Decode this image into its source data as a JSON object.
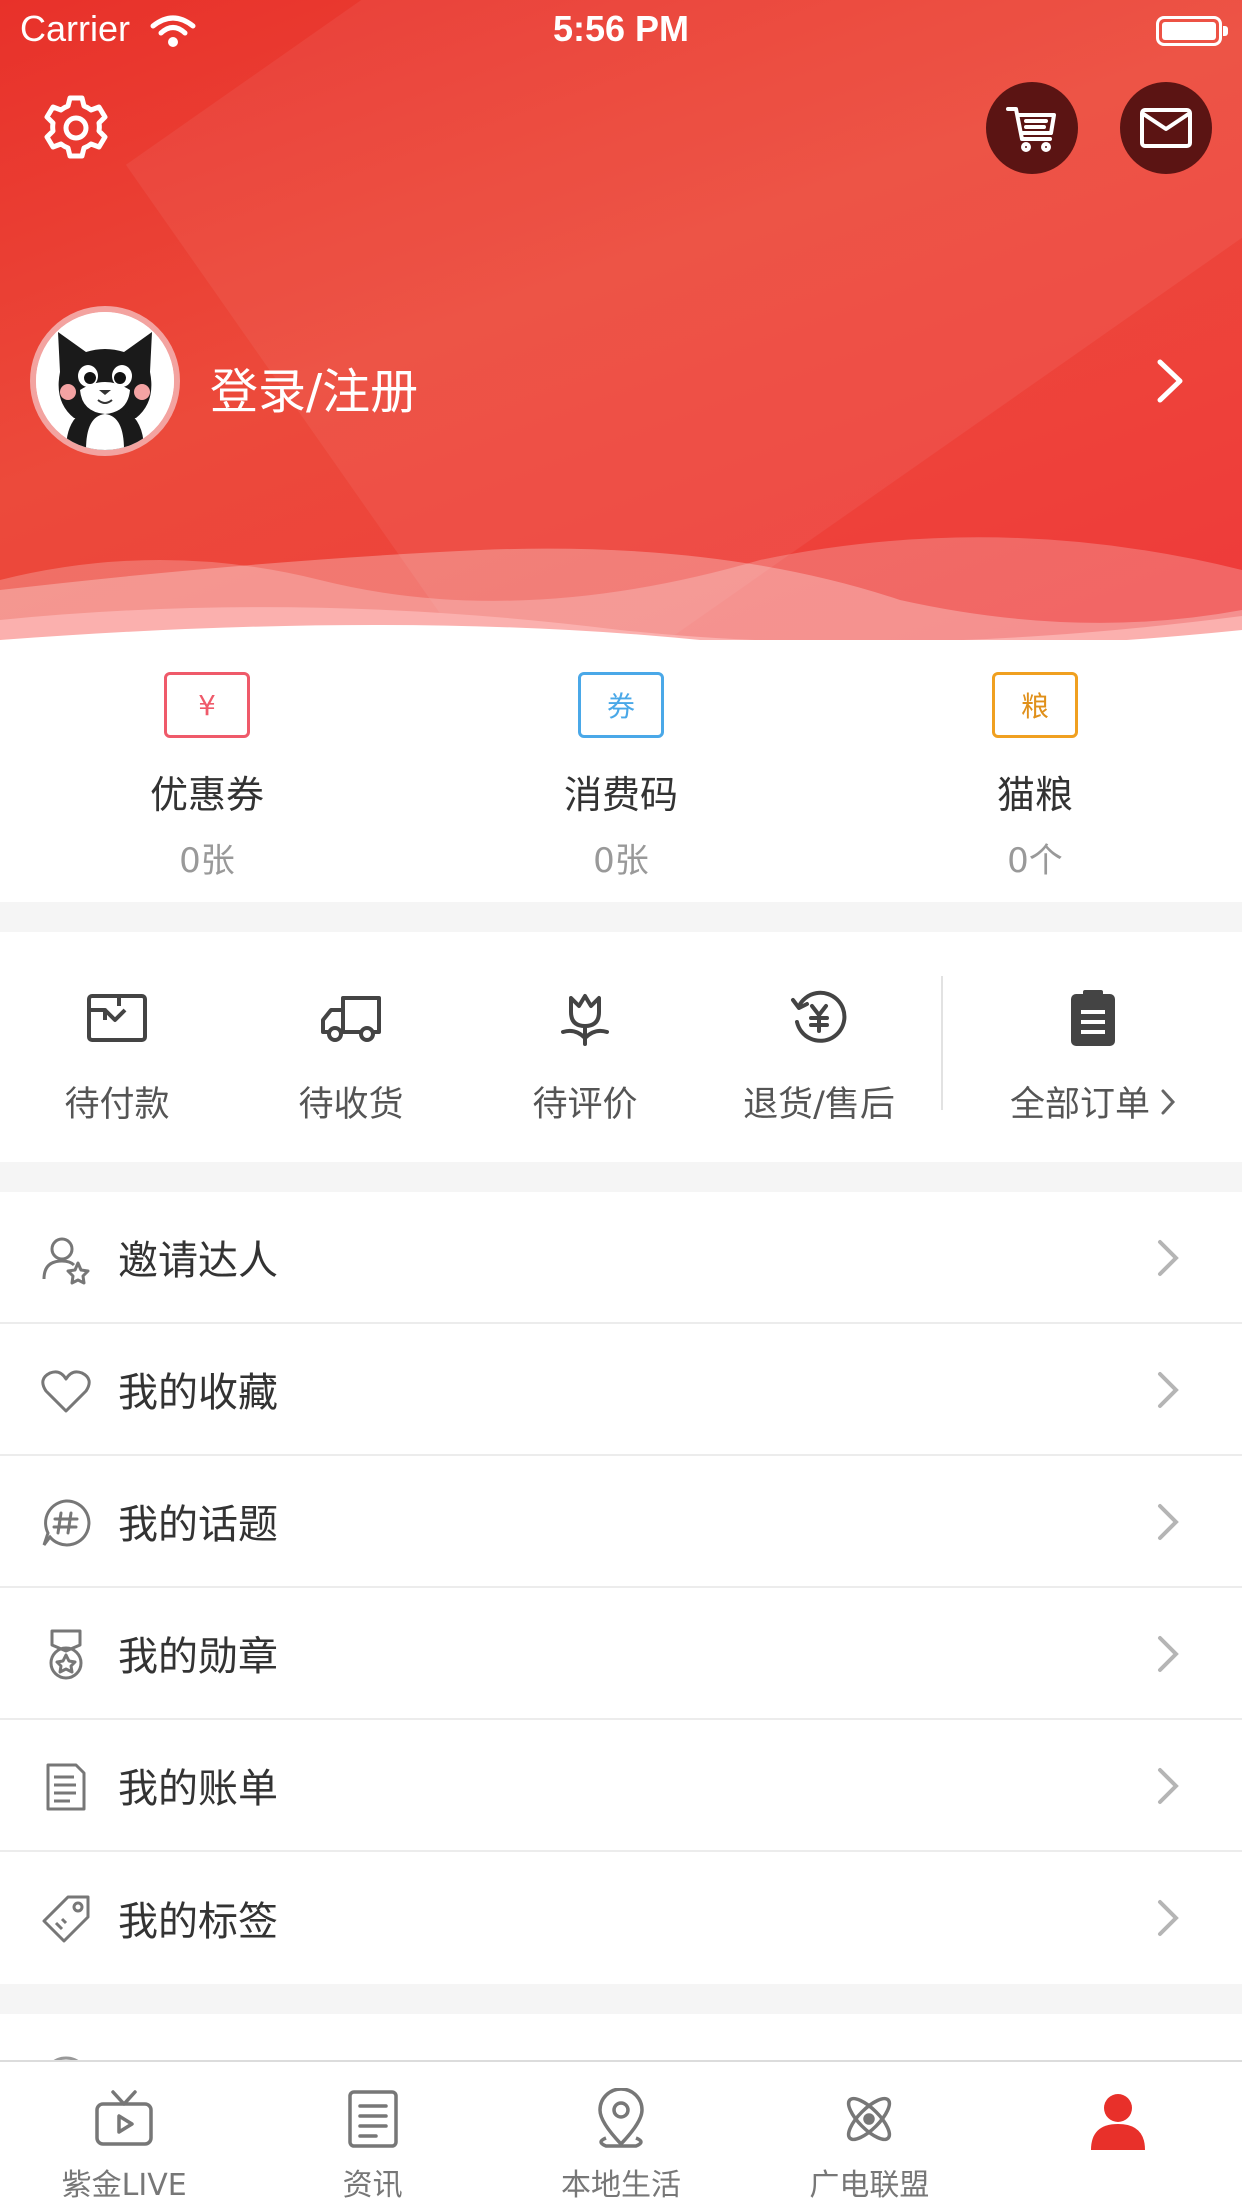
{
  "status_bar": {
    "carrier": "Carrier",
    "time": "5:56 PM"
  },
  "header": {
    "login_label": "登录/注册",
    "colors": {
      "primary_red": "#e8312a",
      "dark_button": "#5b1413"
    }
  },
  "assets": [
    {
      "label": "优惠券",
      "count": "0张",
      "glyph": "¥",
      "color": "#ef5a6a",
      "icon": "coupon-icon"
    },
    {
      "label": "消费码",
      "count": "0张",
      "glyph": "券",
      "color": "#4aa8e8",
      "icon": "voucher-code-icon"
    },
    {
      "label": "猫粮",
      "count": "0个",
      "glyph": "粮",
      "color": "#f0a020",
      "icon": "cat-food-icon"
    }
  ],
  "orders": {
    "items": [
      {
        "label": "待付款",
        "icon": "wallet-icon"
      },
      {
        "label": "待收货",
        "icon": "truck-icon"
      },
      {
        "label": "待评价",
        "icon": "flower-icon"
      },
      {
        "label": "退货/售后",
        "icon": "refund-icon"
      }
    ],
    "all_label": "全部订单"
  },
  "menu": [
    {
      "label": "邀请达人",
      "icon": "invite-user-icon"
    },
    {
      "label": "我的收藏",
      "icon": "heart-icon"
    },
    {
      "label": "我的话题",
      "icon": "topic-hash-icon"
    },
    {
      "label": "我的勋章",
      "icon": "medal-icon"
    },
    {
      "label": "我的账单",
      "icon": "bill-icon"
    },
    {
      "label": "我的标签",
      "icon": "tag-icon"
    }
  ],
  "tabbar": [
    {
      "label": "紫金LIVE",
      "icon": "tv-play-icon"
    },
    {
      "label": "资讯",
      "icon": "news-icon"
    },
    {
      "label": "本地生活",
      "icon": "location-pin-icon"
    },
    {
      "label": "广电联盟",
      "icon": "atom-icon"
    },
    {
      "label": "",
      "icon": "profile-icon",
      "active": true
    }
  ]
}
